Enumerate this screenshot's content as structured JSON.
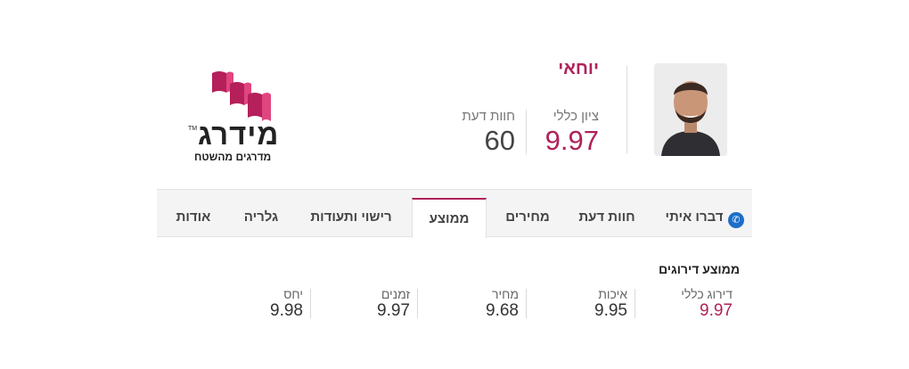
{
  "profile": {
    "business_name": "יוחאי",
    "overall_score_label": "ציון כללי",
    "overall_score_value": "9.97",
    "reviews_label": "חוות דעת",
    "reviews_count": "60"
  },
  "logo": {
    "brand_name": "מידרג",
    "trademark": "TM",
    "tagline": "מדרגים מהשטח"
  },
  "tabs": [
    {
      "label": "דברו איתי",
      "icon": "phone-icon"
    },
    {
      "label": "חוות דעת"
    },
    {
      "label": "מחירים"
    },
    {
      "label": "ממוצע",
      "active": true
    },
    {
      "label": "רישוי ותעודות"
    },
    {
      "label": "גלריה"
    },
    {
      "label": "אודות"
    }
  ],
  "ratings": {
    "title": "ממוצע דירוגים",
    "items": [
      {
        "label": "דירוג כללי",
        "value": "9.97"
      },
      {
        "label": "איכות",
        "value": "9.95"
      },
      {
        "label": "מחיר",
        "value": "9.68"
      },
      {
        "label": "זמנים",
        "value": "9.97"
      },
      {
        "label": "יחס",
        "value": "9.98"
      }
    ]
  },
  "colors": {
    "accent": "#b0225a",
    "logo_pink": "#d6336c",
    "phone_blue": "#1d6ec8"
  }
}
